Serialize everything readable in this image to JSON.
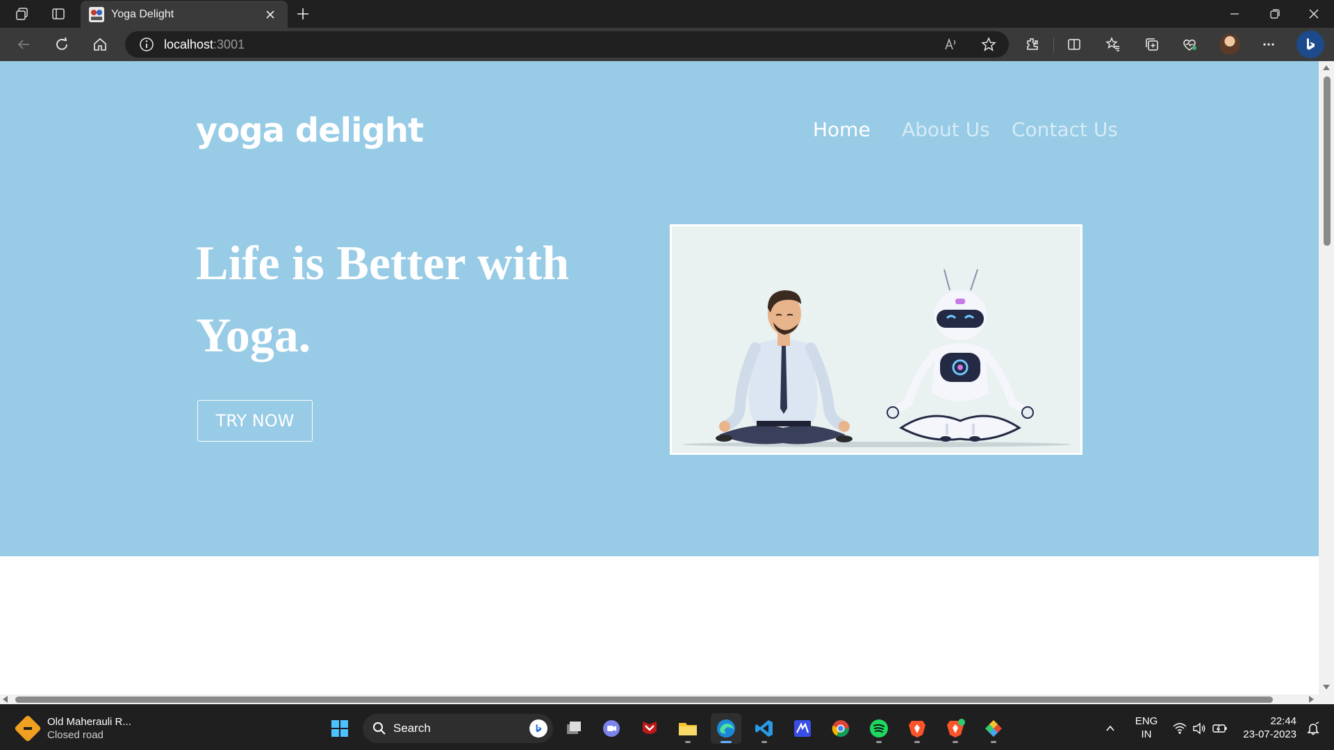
{
  "browser": {
    "tab_title": "Yoga Delight",
    "url_host": "localhost",
    "url_port": ":3001"
  },
  "page": {
    "brand": "yoga delight",
    "nav": {
      "home": "Home",
      "about": "About Us",
      "contact": "Contact Us"
    },
    "headline": "Life is Better with Yoga.",
    "cta_label": "TRY NOW",
    "colors": {
      "hero_bg": "#97cbe6",
      "white": "#ffffff"
    }
  },
  "taskbar": {
    "weather_title": "Old Maherauli R...",
    "weather_subtitle": "Closed road",
    "search_placeholder": "Search",
    "language": "ENG",
    "region": "IN",
    "time": "22:44",
    "date": "23-07-2023"
  }
}
